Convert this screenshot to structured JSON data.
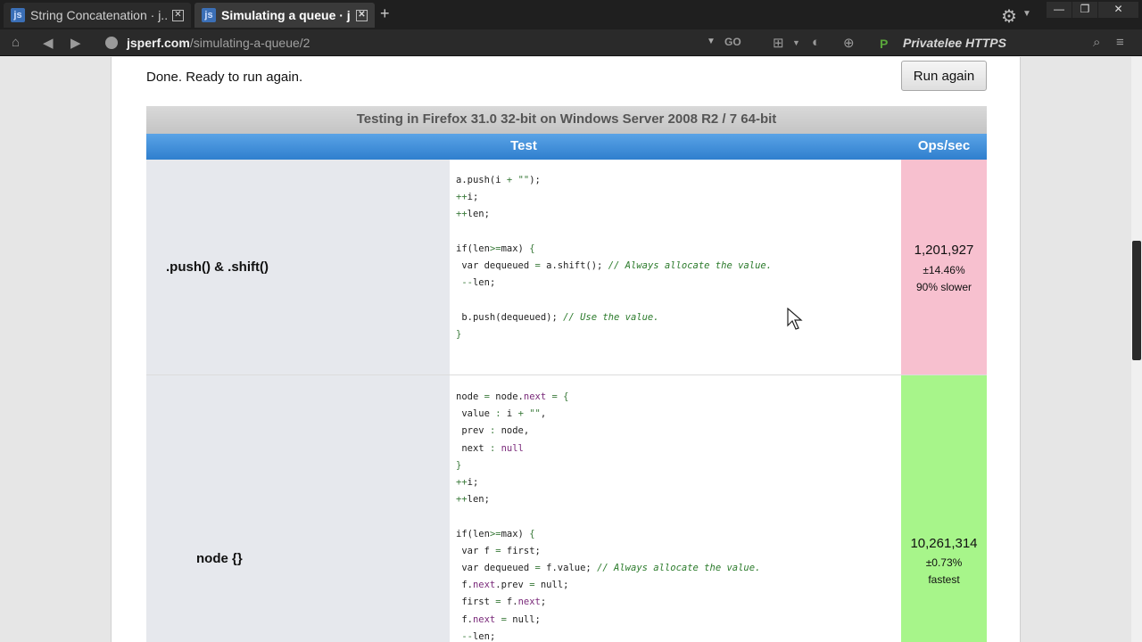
{
  "browser": {
    "tabs": [
      {
        "title": "String Concatenation · j...",
        "active": false
      },
      {
        "title": "Simulating a queue · j...",
        "active": true
      }
    ],
    "new_tab": "+",
    "url_domain": "jsperf.com",
    "url_path": "/simulating-a-queue/2",
    "go_label": "GO",
    "extension_label": "Privatelee HTTPS"
  },
  "page": {
    "status": "Done. Ready to run again.",
    "run_button": "Run again",
    "tested_in": "Testing in Firefox 31.0 32-bit on Windows Server 2008 R2 / 7 64-bit",
    "table": {
      "header_test": "Test",
      "header_ops": "Ops/sec",
      "rows": [
        {
          "name": ".push() & .shift()",
          "ops": "1,201,927",
          "error": "±14.46%",
          "relative": "90% slower",
          "status_color": "#f7c0cf"
        },
        {
          "name": "node {}",
          "ops": "10,261,314",
          "error": "±0.73%",
          "relative": "fastest",
          "status_color": "#a7f58a"
        }
      ]
    }
  },
  "colors": {
    "header_blue": "#2f7fce",
    "slow": "#f7c0cf",
    "fast": "#a7f58a"
  }
}
